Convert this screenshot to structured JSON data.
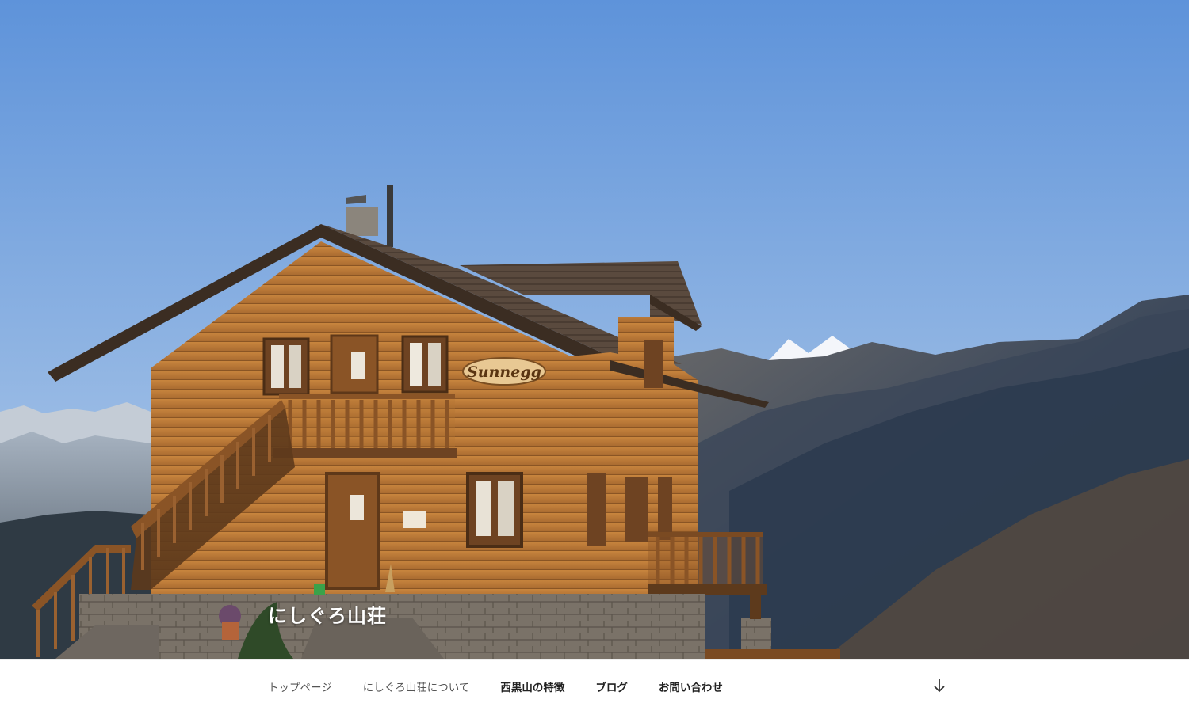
{
  "site": {
    "title": "にしぐろ山荘"
  },
  "hero": {
    "sign_text": "Sunnegg",
    "colors": {
      "sky_top": "#5e93da",
      "sky_bottom": "#b9d0ea",
      "wood": "#c98a46",
      "roof": "#4a3b30"
    }
  },
  "nav": {
    "items": [
      {
        "label": "トップページ"
      },
      {
        "label": "にしぐろ山荘について"
      },
      {
        "label": "西黒山の特徴"
      },
      {
        "label": "ブログ"
      },
      {
        "label": "お問い合わせ"
      }
    ],
    "scroll_icon": "arrow-down-icon"
  }
}
